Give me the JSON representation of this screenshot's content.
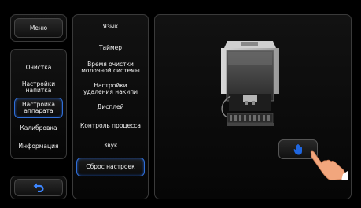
{
  "left_menu": {
    "menu_label": "Меню",
    "items": [
      {
        "label": "Очистка"
      },
      {
        "label": "Настройки напитка"
      },
      {
        "label": "Настройка аппарата",
        "selected": true
      },
      {
        "label": "Калибровка"
      },
      {
        "label": "Информация"
      }
    ],
    "back_icon": "back-arrow-icon"
  },
  "submenu": {
    "items": [
      {
        "label": "Язык"
      },
      {
        "label": "Таймер"
      },
      {
        "label": "Время очистки молочной системы"
      },
      {
        "label": "Настройки удаления накипи"
      },
      {
        "label": "Дисплей"
      },
      {
        "label": "Контроль процесса"
      },
      {
        "label": "Звук"
      },
      {
        "label": "Сброс настроек",
        "selected": true
      }
    ]
  },
  "preview": {
    "machine_icon": "coffee-machine-illustration",
    "action_button_icon": "hand-icon",
    "finger_icon": "pointing-finger-icon"
  },
  "colors": {
    "accent": "#2f6ed8",
    "hand_blue": "#1f66e0",
    "finger_skin": "#f2a67d"
  }
}
